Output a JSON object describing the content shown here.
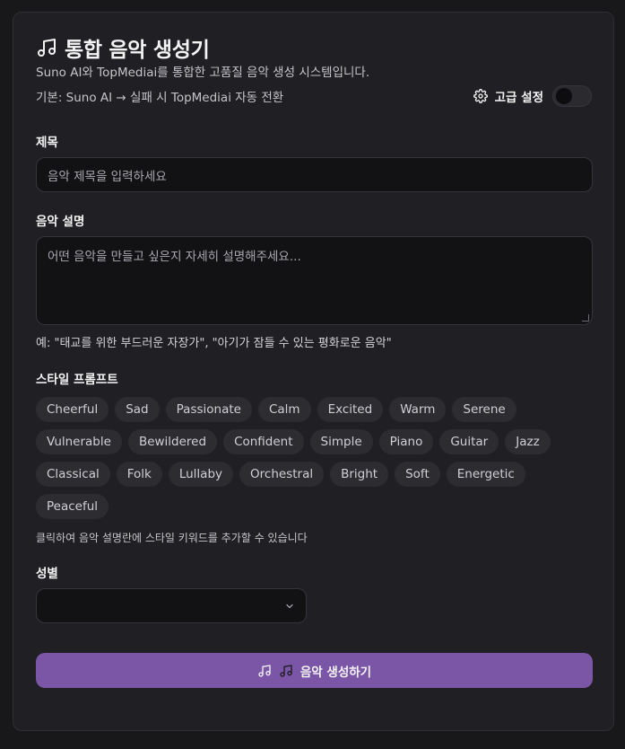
{
  "header": {
    "title": "통합 음악 생성기",
    "subtitle": "Suno AI와 TopMediai를 통합한 고품질 음악 생성 시스템입니다.",
    "fallback_note": "기본: Suno AI → 실패 시 TopMediai 자동 전환",
    "advanced_label": "고급 설정",
    "advanced_enabled": false
  },
  "form": {
    "title_label": "제목",
    "title_placeholder": "음악 제목을 입력하세요",
    "description_label": "음악 설명",
    "description_placeholder": "어떤 음악을 만들고 싶은지 자세히 설명해주세요...",
    "description_example": "예: \"태교를 위한 부드러운 자장가\", \"아기가 잠들 수 있는 평화로운 음악\"",
    "style_label": "스타일 프롬프트",
    "styles": [
      "Cheerful",
      "Sad",
      "Passionate",
      "Calm",
      "Excited",
      "Warm",
      "Serene",
      "Vulnerable",
      "Bewildered",
      "Confident",
      "Simple",
      "Piano",
      "Guitar",
      "Jazz",
      "Classical",
      "Folk",
      "Lullaby",
      "Orchestral",
      "Bright",
      "Soft",
      "Energetic",
      "Peaceful"
    ],
    "style_hint": "클릭하여 음악 설명란에 스타일 키워드를 추가할 수 있습니다",
    "gender_label": "성별",
    "gender_value": "",
    "generate_label": "음악 생성하기"
  },
  "colors": {
    "accent": "#7b55a6",
    "background": "#18181b",
    "card": "#202024"
  }
}
